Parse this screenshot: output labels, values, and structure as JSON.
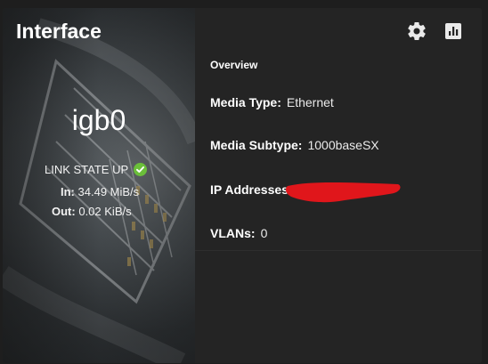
{
  "card": {
    "title": "Interface",
    "interface_name": "igb0",
    "link_state": "LINK STATE UP",
    "traffic": {
      "in_label": "In:",
      "in_value": "34.49 MiB/s",
      "out_label": "Out:",
      "out_value": "0.02 KiB/s"
    }
  },
  "toolbar": {
    "settings_icon": "gear-icon",
    "reports_icon": "bar-chart-icon"
  },
  "overview": {
    "heading": "Overview",
    "media_type_label": "Media Type:",
    "media_type_value": "Ethernet",
    "media_subtype_label": "Media Subtype:",
    "media_subtype_value": "1000baseSX",
    "ip_addresses_label": "IP Addresses:",
    "vlans_label": "VLANs:",
    "vlans_value": "0"
  },
  "colors": {
    "background": "#1e1e1e",
    "card": "#242424",
    "link_up_green": "#6bbf3a",
    "redaction_red": "#e0161b"
  }
}
